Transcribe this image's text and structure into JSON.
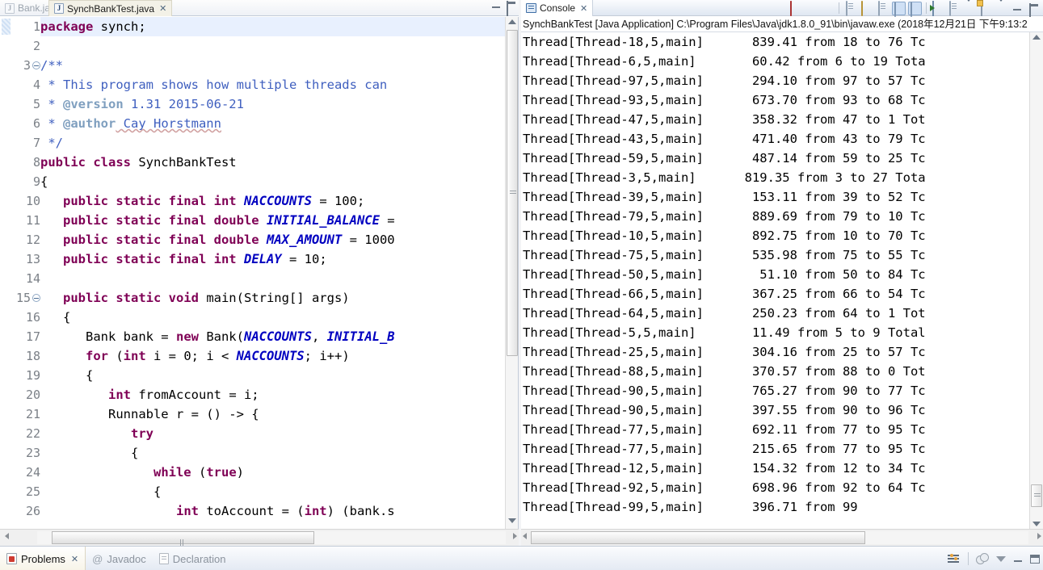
{
  "editor": {
    "tabs": [
      {
        "label": "Bank.java",
        "active": false,
        "icon": "java-file-icon"
      },
      {
        "label": "SynchBankTest.java",
        "active": true,
        "icon": "java-file-icon"
      }
    ],
    "window_controls": [
      {
        "name": "minimize-editor-button",
        "icon": "minimize-icon"
      },
      {
        "name": "maximize-editor-button",
        "icon": "maximize-icon"
      }
    ],
    "lines": [
      {
        "n": "1",
        "fold": false,
        "highlight": true,
        "tokens": [
          {
            "t": "package",
            "c": "kw"
          },
          {
            "t": " synch;",
            "c": ""
          }
        ]
      },
      {
        "n": "2",
        "fold": false,
        "highlight": false,
        "tokens": [
          {
            "t": "",
            "c": ""
          }
        ]
      },
      {
        "n": "3",
        "fold": true,
        "highlight": false,
        "tokens": [
          {
            "t": "/**",
            "c": "cm"
          }
        ]
      },
      {
        "n": "4",
        "fold": false,
        "highlight": false,
        "tokens": [
          {
            "t": " * This program shows how multiple threads can",
            "c": "cm"
          }
        ]
      },
      {
        "n": "5",
        "fold": false,
        "highlight": false,
        "tokens": [
          {
            "t": " * ",
            "c": "cm"
          },
          {
            "t": "@version",
            "c": "cmtag"
          },
          {
            "t": " 1.31 2015-06-21",
            "c": "cm"
          }
        ]
      },
      {
        "n": "6",
        "fold": false,
        "highlight": false,
        "tokens": [
          {
            "t": " * ",
            "c": "cm"
          },
          {
            "t": "@author",
            "c": "cmtag"
          },
          {
            "t": " Cay Horstmann",
            "c": "cm spell"
          }
        ]
      },
      {
        "n": "7",
        "fold": false,
        "highlight": false,
        "tokens": [
          {
            "t": " */",
            "c": "cm"
          }
        ]
      },
      {
        "n": "8",
        "fold": false,
        "highlight": false,
        "tokens": [
          {
            "t": "public class",
            "c": "kw"
          },
          {
            "t": " SynchBankTest",
            "c": ""
          }
        ]
      },
      {
        "n": "9",
        "fold": false,
        "highlight": false,
        "tokens": [
          {
            "t": "{",
            "c": ""
          }
        ]
      },
      {
        "n": "10",
        "fold": false,
        "highlight": false,
        "tokens": [
          {
            "t": "   ",
            "c": ""
          },
          {
            "t": "public static final int",
            "c": "kw"
          },
          {
            "t": " ",
            "c": ""
          },
          {
            "t": "NACCOUNTS",
            "c": "cst"
          },
          {
            "t": " = 100;",
            "c": ""
          }
        ]
      },
      {
        "n": "11",
        "fold": false,
        "highlight": false,
        "tokens": [
          {
            "t": "   ",
            "c": ""
          },
          {
            "t": "public static final double",
            "c": "kw"
          },
          {
            "t": " ",
            "c": ""
          },
          {
            "t": "INITIAL_BALANCE",
            "c": "cst"
          },
          {
            "t": " =",
            "c": ""
          }
        ]
      },
      {
        "n": "12",
        "fold": false,
        "highlight": false,
        "tokens": [
          {
            "t": "   ",
            "c": ""
          },
          {
            "t": "public static final double",
            "c": "kw"
          },
          {
            "t": " ",
            "c": ""
          },
          {
            "t": "MAX_AMOUNT",
            "c": "cst"
          },
          {
            "t": " = 1000",
            "c": ""
          }
        ]
      },
      {
        "n": "13",
        "fold": false,
        "highlight": false,
        "tokens": [
          {
            "t": "   ",
            "c": ""
          },
          {
            "t": "public static final int",
            "c": "kw"
          },
          {
            "t": " ",
            "c": ""
          },
          {
            "t": "DELAY",
            "c": "cst"
          },
          {
            "t": " = 10;",
            "c": ""
          }
        ]
      },
      {
        "n": "14",
        "fold": false,
        "highlight": false,
        "tokens": [
          {
            "t": "",
            "c": ""
          }
        ]
      },
      {
        "n": "15",
        "fold": true,
        "highlight": false,
        "tokens": [
          {
            "t": "   ",
            "c": ""
          },
          {
            "t": "public static void",
            "c": "kw"
          },
          {
            "t": " main(String[] args)",
            "c": ""
          }
        ]
      },
      {
        "n": "16",
        "fold": false,
        "highlight": false,
        "tokens": [
          {
            "t": "   {",
            "c": ""
          }
        ]
      },
      {
        "n": "17",
        "fold": false,
        "highlight": false,
        "tokens": [
          {
            "t": "      Bank bank = ",
            "c": ""
          },
          {
            "t": "new",
            "c": "kw"
          },
          {
            "t": " Bank(",
            "c": ""
          },
          {
            "t": "NACCOUNTS",
            "c": "cst"
          },
          {
            "t": ", ",
            "c": ""
          },
          {
            "t": "INITIAL_B",
            "c": "cst"
          }
        ]
      },
      {
        "n": "18",
        "fold": false,
        "highlight": false,
        "tokens": [
          {
            "t": "      ",
            "c": ""
          },
          {
            "t": "for",
            "c": "kw"
          },
          {
            "t": " (",
            "c": ""
          },
          {
            "t": "int",
            "c": "kw"
          },
          {
            "t": " i = 0; i < ",
            "c": ""
          },
          {
            "t": "NACCOUNTS",
            "c": "cst"
          },
          {
            "t": "; i++)",
            "c": ""
          }
        ]
      },
      {
        "n": "19",
        "fold": false,
        "highlight": false,
        "tokens": [
          {
            "t": "      {",
            "c": ""
          }
        ]
      },
      {
        "n": "20",
        "fold": false,
        "highlight": false,
        "tokens": [
          {
            "t": "         ",
            "c": ""
          },
          {
            "t": "int",
            "c": "kw"
          },
          {
            "t": " fromAccount = i;",
            "c": ""
          }
        ]
      },
      {
        "n": "21",
        "fold": false,
        "highlight": false,
        "tokens": [
          {
            "t": "         Runnable r = () -> {",
            "c": ""
          }
        ]
      },
      {
        "n": "22",
        "fold": false,
        "highlight": false,
        "tokens": [
          {
            "t": "            ",
            "c": ""
          },
          {
            "t": "try",
            "c": "kw"
          }
        ]
      },
      {
        "n": "23",
        "fold": false,
        "highlight": false,
        "tokens": [
          {
            "t": "            {",
            "c": ""
          }
        ]
      },
      {
        "n": "24",
        "fold": false,
        "highlight": false,
        "tokens": [
          {
            "t": "               ",
            "c": ""
          },
          {
            "t": "while",
            "c": "kw"
          },
          {
            "t": " (",
            "c": ""
          },
          {
            "t": "true",
            "c": "kw"
          },
          {
            "t": ")",
            "c": ""
          }
        ]
      },
      {
        "n": "25",
        "fold": false,
        "highlight": false,
        "tokens": [
          {
            "t": "               {",
            "c": ""
          }
        ]
      },
      {
        "n": "26",
        "fold": false,
        "highlight": false,
        "tokens": [
          {
            "t": "                  ",
            "c": ""
          },
          {
            "t": "int",
            "c": "kw"
          },
          {
            "t": " toAccount = (",
            "c": ""
          },
          {
            "t": "int",
            "c": "kw"
          },
          {
            "t": ") (bank.s",
            "c": ""
          }
        ]
      }
    ]
  },
  "console": {
    "tab_label": "Console",
    "title": "SynchBankTest [Java Application] C:\\Program Files\\Java\\jdk1.8.0_91\\bin\\javaw.exe (2018年12月21日 下午9:13:2",
    "toolbar": [
      {
        "name": "terminate-button",
        "icon": "stop-icon"
      },
      {
        "name": "remove-launch-button",
        "icon": "remove-x-icon"
      },
      {
        "name": "remove-all-terminated-button",
        "icon": "remove-all-x-icon"
      },
      {
        "name": "clear-console-button",
        "icon": "clear-console-icon"
      },
      {
        "name": "scroll-lock-button",
        "icon": "lock-icon"
      },
      {
        "name": "show-console-on-output-button",
        "icon": "show-console-icon"
      },
      {
        "name": "pin-console-button",
        "icon": "pin-console-icon"
      },
      {
        "name": "display-selected-console-button",
        "icon": "display-console-icon"
      },
      {
        "name": "open-console-button",
        "icon": "open-console-icon"
      },
      {
        "name": "new-console-view-button",
        "icon": "new-console-icon"
      },
      {
        "name": "minimize-console-button",
        "icon": "minimize-icon"
      },
      {
        "name": "maximize-console-button",
        "icon": "maximize-icon"
      }
    ],
    "output": [
      {
        "thread": "Thread[Thread-18,5,main]",
        "amount": "839.41",
        "tail": "from 18 to 76 Tc"
      },
      {
        "thread": "Thread[Thread-6,5,main]",
        "amount": "60.42",
        "tail": "from 6 to 19 Tota"
      },
      {
        "thread": "Thread[Thread-97,5,main]",
        "amount": "294.10",
        "tail": "from 97 to 57 Tc"
      },
      {
        "thread": "Thread[Thread-93,5,main]",
        "amount": "673.70",
        "tail": "from 93 to 68 Tc"
      },
      {
        "thread": "Thread[Thread-47,5,main]",
        "amount": "358.32",
        "tail": "from 47 to 1 Tot"
      },
      {
        "thread": "Thread[Thread-43,5,main]",
        "amount": "471.40",
        "tail": "from 43 to 79 Tc"
      },
      {
        "thread": "Thread[Thread-59,5,main]",
        "amount": "487.14",
        "tail": "from 59 to 25 Tc"
      },
      {
        "thread": "Thread[Thread-3,5,main]",
        "amount": "819.35",
        "tail": "from 3 to 27 Tota"
      },
      {
        "thread": "Thread[Thread-39,5,main]",
        "amount": "153.11",
        "tail": "from 39 to 52 Tc"
      },
      {
        "thread": "Thread[Thread-79,5,main]",
        "amount": "889.69",
        "tail": "from 79 to 10 Tc"
      },
      {
        "thread": "Thread[Thread-10,5,main]",
        "amount": "892.75",
        "tail": "from 10 to 70 Tc"
      },
      {
        "thread": "Thread[Thread-75,5,main]",
        "amount": "535.98",
        "tail": "from 75 to 55 Tc"
      },
      {
        "thread": "Thread[Thread-50,5,main]",
        "amount": "51.10",
        "tail": "from 50 to 84 Tc"
      },
      {
        "thread": "Thread[Thread-66,5,main]",
        "amount": "367.25",
        "tail": "from 66 to 54 Tc"
      },
      {
        "thread": "Thread[Thread-64,5,main]",
        "amount": "250.23",
        "tail": "from 64 to 1 Tot"
      },
      {
        "thread": "Thread[Thread-5,5,main]",
        "amount": "11.49",
        "tail": "from 5 to 9 Total"
      },
      {
        "thread": "Thread[Thread-25,5,main]",
        "amount": "304.16",
        "tail": "from 25 to 57 Tc"
      },
      {
        "thread": "Thread[Thread-88,5,main]",
        "amount": "370.57",
        "tail": "from 88 to 0 Tot"
      },
      {
        "thread": "Thread[Thread-90,5,main]",
        "amount": "765.27",
        "tail": "from 90 to 77 Tc"
      },
      {
        "thread": "Thread[Thread-90,5,main]",
        "amount": "397.55",
        "tail": "from 90 to 96 Tc"
      },
      {
        "thread": "Thread[Thread-77,5,main]",
        "amount": "692.11",
        "tail": "from 77 to 95 Tc"
      },
      {
        "thread": "Thread[Thread-77,5,main]",
        "amount": "215.65",
        "tail": "from 77 to 95 Tc"
      },
      {
        "thread": "Thread[Thread-12,5,main]",
        "amount": "154.32",
        "tail": "from 12 to 34 Tc"
      },
      {
        "thread": "Thread[Thread-92,5,main]",
        "amount": "698.96",
        "tail": "from 92 to 64 Tc"
      },
      {
        "thread": "Thread[Thread-99,5,main]",
        "amount": "396.71",
        "tail": "from 99"
      }
    ]
  },
  "bottom": {
    "tabs": [
      {
        "label": "Problems",
        "active": true,
        "icon": "problems-icon",
        "closeable": true
      },
      {
        "label": "Javadoc",
        "active": false,
        "icon": "javadoc-at-icon",
        "closeable": false
      },
      {
        "label": "Declaration",
        "active": false,
        "icon": "declaration-icon",
        "closeable": false
      }
    ],
    "right_controls": [
      {
        "name": "filter-button",
        "icon": "filter-icon"
      },
      {
        "name": "view-menu-button",
        "icon": "view-menu-icon"
      },
      {
        "name": "collapse-caret-button",
        "icon": "caret-down-icon"
      },
      {
        "name": "minimize-view-button",
        "icon": "minimize-icon"
      },
      {
        "name": "maximize-view-button",
        "icon": "maximize-icon"
      }
    ]
  }
}
